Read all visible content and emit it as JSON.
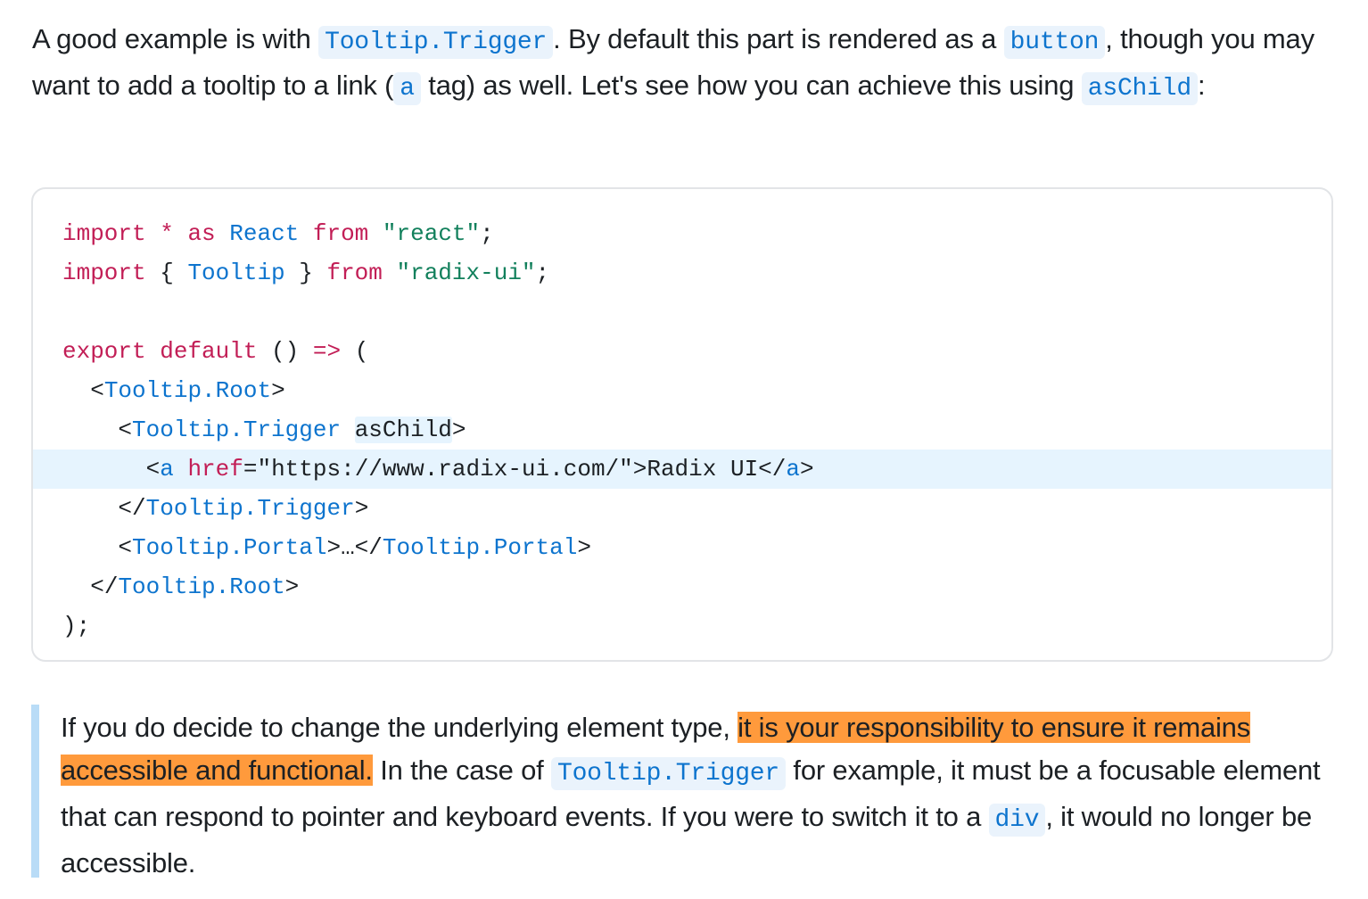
{
  "intro": {
    "t1": "A good example is with ",
    "c1": "Tooltip.Trigger",
    "t2": ". By default this part is rendered as a ",
    "c2": "button",
    "t3": ", though you may want to add a tooltip to a link (",
    "c3": "a",
    "t4": " tag) as well. Let's see how you can achieve this using ",
    "c4": "asChild",
    "t5": ":"
  },
  "code": {
    "l1": {
      "kw1": "import",
      "star": " * ",
      "kw2": "as",
      "id": " React ",
      "kw3": "from",
      "sp": " ",
      "str": "\"react\"",
      "end": ";"
    },
    "l2": {
      "kw1": "import",
      "p1": " { ",
      "id": "Tooltip",
      "p2": " } ",
      "kw2": "from",
      "sp": " ",
      "str": "\"radix-ui\"",
      "end": ";"
    },
    "l4": {
      "kw1": "export",
      "sp": " ",
      "kw2": "default",
      "p1": " () ",
      "arrow": "=>",
      "p2": " ("
    },
    "l5": {
      "indent": "  ",
      "open": "<",
      "tag": "Tooltip.Root",
      "close": ">"
    },
    "l6": {
      "indent": "    ",
      "open": "<",
      "tag": "Tooltip.Trigger",
      "sp": " ",
      "attr": "asChild",
      "close": ">"
    },
    "l7": {
      "indent": "      ",
      "open": "<",
      "tag": "a",
      "sp": " ",
      "attr": "href",
      "eq": "=\"https://www.radix-ui.com/\">Radix UI</",
      "tag2": "a",
      "close": ">"
    },
    "l8": {
      "indent": "    ",
      "open": "</",
      "tag": "Tooltip.Trigger",
      "close": ">"
    },
    "l9": {
      "indent": "    ",
      "open": "<",
      "tag": "Tooltip.Portal",
      "mid": ">…</",
      "tag2": "Tooltip.Portal",
      "close": ">"
    },
    "l10": {
      "indent": "  ",
      "open": "</",
      "tag": "Tooltip.Root",
      "close": ">"
    },
    "l11": {
      "text": ");"
    }
  },
  "note": {
    "t1": "If you do decide to change the underlying element type, ",
    "highlight": "it is your responsibility to ensure it remains accessible and functional.",
    "t2": " In the case of ",
    "c1": "Tooltip.Trigger",
    "t3": " for example, it must be a focusable element that can respond to pointer and keyboard events. If you were to switch it to a ",
    "c2": "div",
    "t4": ", it would no longer be accessible."
  },
  "colors": {
    "keyword": "#c21e56",
    "identifier": "#0d74ce",
    "string": "#12805c",
    "highlight": "#ff9a3c",
    "callout_border": "#b9dcf7"
  }
}
